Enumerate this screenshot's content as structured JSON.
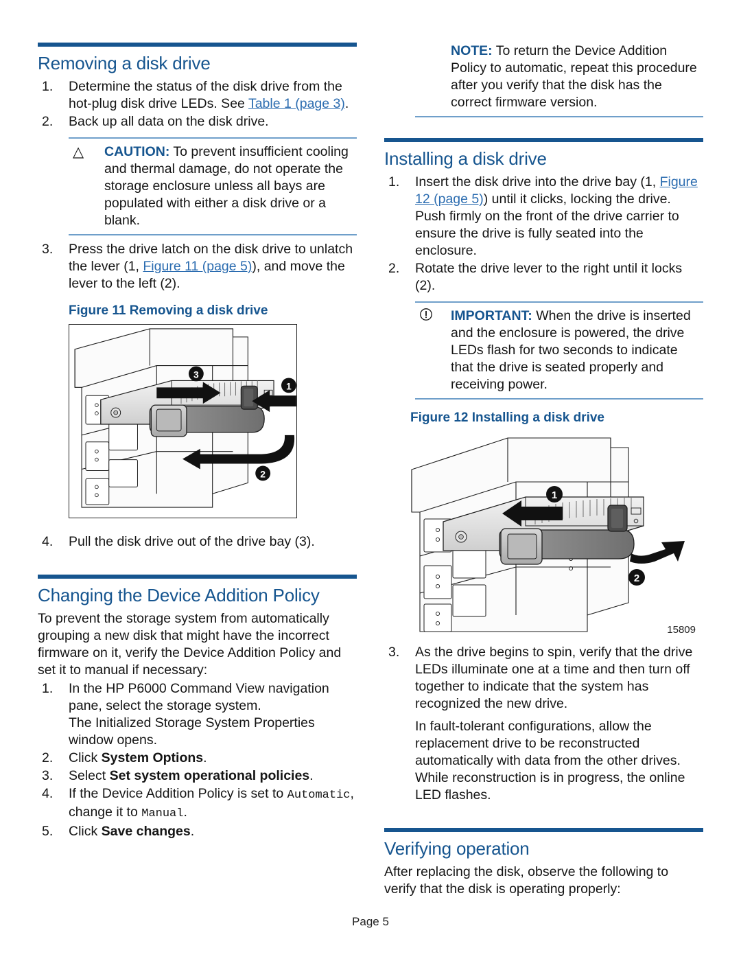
{
  "footer": {
    "page_label": "Page 5"
  },
  "colors": {
    "heading_blue": "#16558f",
    "link_blue": "#2b6cb0",
    "rule_blue": "#16558f",
    "admon_rule_blue": "#6f9fca"
  },
  "left_column": {
    "section1": {
      "title": "Removing a disk drive",
      "steps": [
        {
          "num": "1.",
          "text_before": "Determine the status of the disk drive from the hot-plug disk drive LEDs. See ",
          "link": "Table 1 (page 3)",
          "text_after": "."
        },
        {
          "num": "2.",
          "text_before": "Back up all data on the disk drive.",
          "link": "",
          "text_after": ""
        }
      ],
      "caution": {
        "glyph": "caution-triangle-icon",
        "glyph_char": "△",
        "label": "CAUTION:",
        "text": "To prevent insufficient cooling and thermal damage, do not operate the storage enclosure unless all bays are populated with either a disk drive or a blank."
      },
      "step3": {
        "num": "3.",
        "text_before": "Press the drive latch on the disk drive to unlatch the lever (1, ",
        "link": "Figure 11 (page 5)",
        "text_after": "), and move the lever to the left (2)."
      },
      "figure": {
        "caption": "Figure 11 Removing a disk drive",
        "callouts": [
          "3",
          "1",
          "2"
        ]
      },
      "step4": {
        "num": "4.",
        "text": "Pull the disk drive out of the drive bay (3)."
      }
    },
    "section2": {
      "title": "Changing the Device Addition Policy",
      "intro": "To prevent the storage system from automatically grouping a new disk that might have the incorrect firmware on it, verify the Device Addition Policy and set it to manual if necessary:",
      "steps": [
        {
          "num": "1.",
          "text": "In the HP P6000 Command View navigation pane, select the storage system."
        }
      ],
      "substep_text": "The Initialized Storage System Properties window opens.",
      "steps_rest": [
        {
          "num": "2.",
          "pre": "Click ",
          "bold": "System Options",
          "post": "."
        },
        {
          "num": "3.",
          "pre": "Select ",
          "bold": "Set system operational policies",
          "post": "."
        },
        {
          "num": "4.",
          "pre": "If the Device Addition Policy is set to ",
          "mono1": "Automatic",
          "mid": ", change it to ",
          "mono2": "Manual",
          "post": "."
        },
        {
          "num": "5.",
          "pre": "Click ",
          "bold": "Save changes",
          "post": "."
        }
      ]
    }
  },
  "right_column": {
    "note": {
      "glyph": "note-icon",
      "label": "NOTE:",
      "text": "To return the Device Addition Policy to automatic, repeat this procedure after you verify that the disk has the correct firmware version."
    },
    "section1": {
      "title": "Installing a disk drive",
      "step1": {
        "num": "1.",
        "text_before": "Insert the disk drive into the drive bay (1, ",
        "link": "Figure 12 (page 5)",
        "text_after": ") until it clicks, locking the drive. Push firmly on the front of the drive carrier to ensure the drive is fully seated into the enclosure."
      },
      "step2": {
        "num": "2.",
        "text": "Rotate the drive lever to the right until it locks (2)."
      },
      "important": {
        "glyph": "important-exclamation-icon",
        "glyph_char": "ⓘ",
        "label": "IMPORTANT:",
        "text": "When the drive is inserted and the enclosure is powered, the drive LEDs flash for two seconds to indicate that the drive is seated properly and receiving power."
      },
      "figure": {
        "caption": "Figure 12 Installing a disk drive",
        "callouts": [
          "1",
          "2"
        ],
        "figure_id": "15809"
      },
      "step3": {
        "num": "3.",
        "text": "As the drive begins to spin, verify that the drive LEDs illuminate one at a time and then turn off together to indicate that the system has recognized the new drive."
      },
      "step3_sub": "In fault-tolerant configurations, allow the replacement drive to be reconstructed automatically with data from the other drives. While reconstruction is in progress, the online LED flashes."
    },
    "section2": {
      "title": "Verifying operation",
      "intro": "After replacing the disk, observe the following to verify that the disk is operating properly:"
    }
  }
}
